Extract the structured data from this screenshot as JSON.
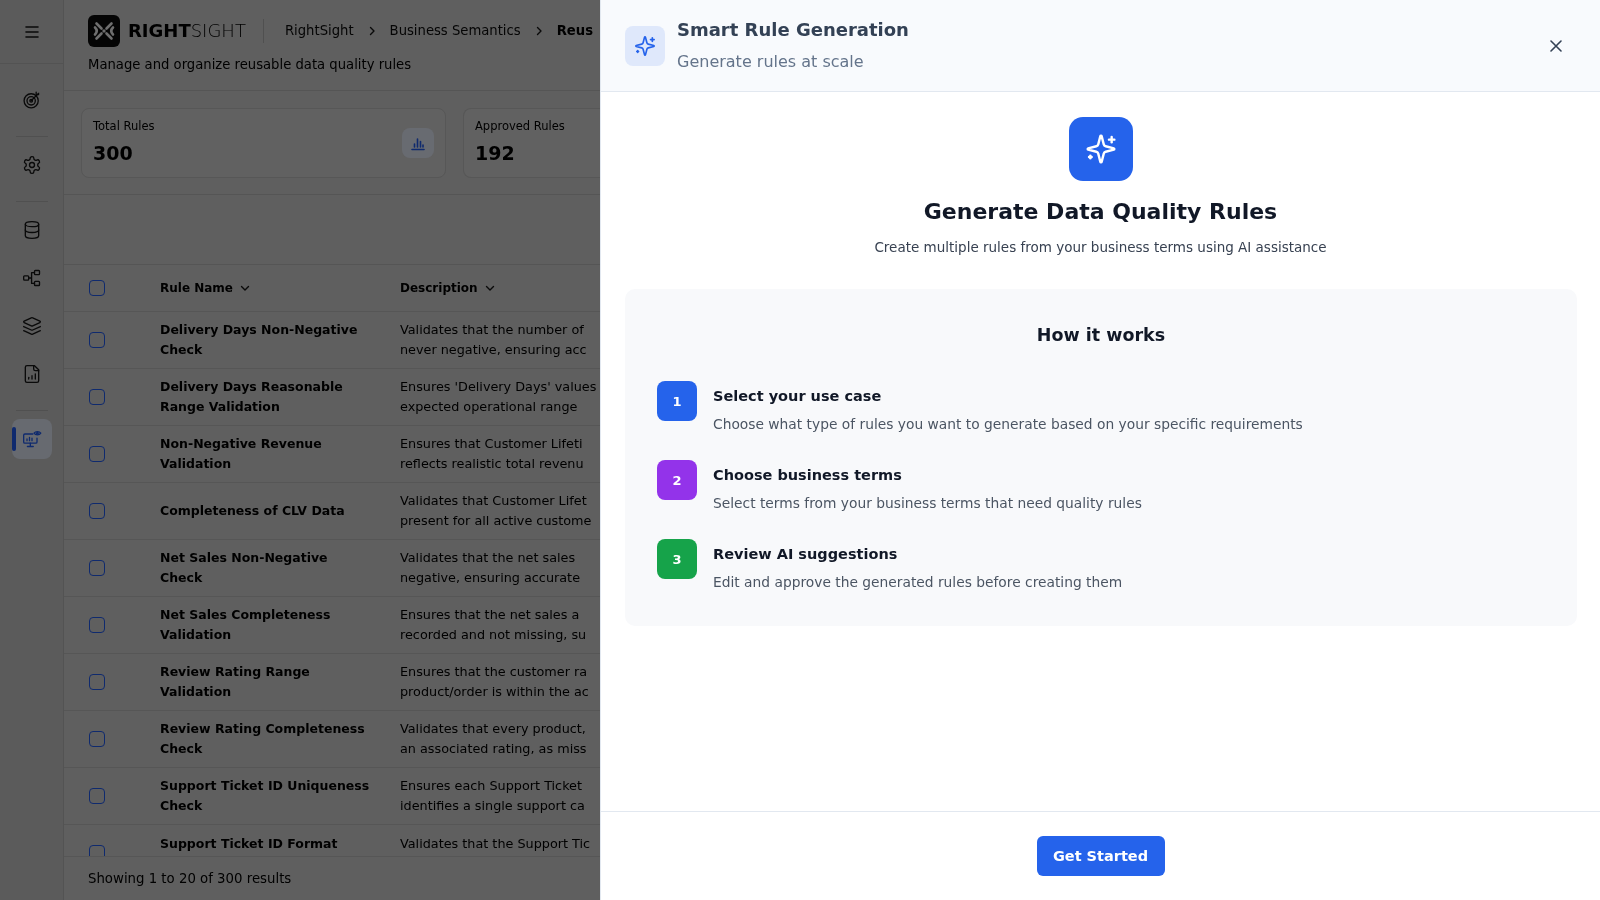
{
  "sidebar": {
    "groups": [
      {
        "items": [
          {
            "selected": false
          }
        ]
      },
      {
        "items": [
          {
            "selected": false
          }
        ]
      },
      {
        "items": [
          {
            "selected": false
          },
          {
            "selected": false
          },
          {
            "selected": false
          },
          {
            "selected": false
          }
        ]
      },
      {
        "items": [
          {
            "selected": true
          }
        ]
      }
    ]
  },
  "header": {
    "logo": "**RIGHT**SIGHT",
    "breadcrumb": [
      {
        "label": "RightSight",
        "current": false
      },
      {
        "label": "Business Semantics",
        "current": false
      },
      {
        "label": "Reus",
        "current": true
      }
    ],
    "subtitle": "Manage and organize reusable data quality rules"
  },
  "stats": [
    {
      "label": "Total Rules",
      "value": "300",
      "show_icon": true
    },
    {
      "label": "Approved Rules",
      "value": "192"
    }
  ],
  "table": {
    "select_all": {
      "checked": false
    },
    "columns": [
      {
        "label": "Rule Name",
        "sortable": true
      },
      {
        "label": "Description",
        "sortable": true
      }
    ],
    "rows": [
      {
        "name": "Delivery Days Non-Negative Check",
        "description_lines": [
          "Validates that the number of",
          "never negative, ensuring acc"
        ],
        "selected": false
      },
      {
        "name": "Delivery Days Reasonable Range Validation",
        "description_lines": [
          "Ensures 'Delivery Days' values",
          "expected operational range"
        ],
        "selected": false
      },
      {
        "name": "Non-Negative Revenue Validation",
        "description_lines": [
          "Ensures that Customer Lifeti",
          "reflects realistic total revenu"
        ],
        "selected": false
      },
      {
        "name": "Completeness of CLV Data",
        "description_lines": [
          "Validates that Customer Lifet",
          "present for all active custome"
        ],
        "selected": false
      },
      {
        "name": "Net Sales Non-Negative Check",
        "description_lines": [
          "Validates that the net sales",
          "negative, ensuring accurate"
        ],
        "selected": false
      },
      {
        "name": "Net Sales Completeness Validation",
        "description_lines": [
          "Ensures that the net sales a",
          "recorded and not missing, su"
        ],
        "selected": false
      },
      {
        "name": "Review Rating Range Validation",
        "description_lines": [
          "Ensures that the customer ra",
          "product/order is within the ac"
        ],
        "selected": false
      },
      {
        "name": "Review Rating Completeness Check",
        "description_lines": [
          "Validates that every product,",
          "an associated rating, as miss"
        ],
        "selected": false
      },
      {
        "name": "Support Ticket ID Uniqueness Check",
        "description_lines": [
          "Ensures each Support Ticket",
          "identifies a single support ca"
        ],
        "selected": false
      },
      {
        "name": "Support Ticket ID Format",
        "description_lines": [
          "Validates that the Support Tic"
        ],
        "selected": false
      }
    ],
    "footer": "Showing 1 to 20 of 300 results"
  },
  "panel": {
    "title": "Smart Rule Generation",
    "subtitle": "Generate rules at scale",
    "heading": "Generate Data Quality Rules",
    "description": "Create multiple rules from your business terms using AI assistance",
    "how_it_works": {
      "title": "How it works",
      "steps": [
        {
          "number": "1",
          "title": "Select your use case",
          "description": "Choose what type of rules you want to generate based on your specific requirements",
          "color": "#2563eb"
        },
        {
          "number": "2",
          "title": "Choose business terms",
          "description": "Select terms from your business terms that need quality rules",
          "color": "#9333ea"
        },
        {
          "number": "3",
          "title": "Review AI suggestions",
          "description": "Edit and approve the generated rules before creating them",
          "color": "#16a34a"
        }
      ]
    },
    "primary_button": "Get Started"
  }
}
